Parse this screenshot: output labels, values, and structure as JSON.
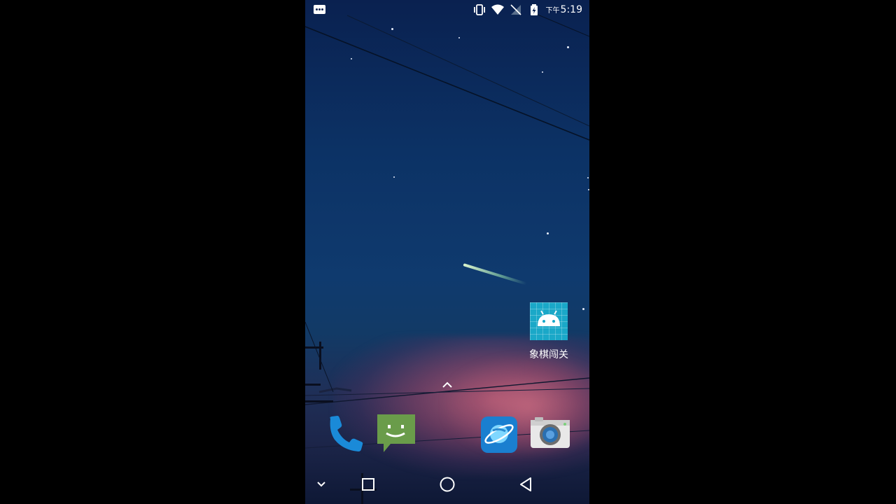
{
  "status_bar": {
    "ampm": "下午",
    "time": "5:19",
    "icons": [
      "notification-dots-icon",
      "vibrate-icon",
      "wifi-icon",
      "no-signal-icon",
      "battery-charging-icon"
    ]
  },
  "desktop": {
    "app": {
      "label": "象棋闯关",
      "icon": "android-icon"
    }
  },
  "dock": {
    "apps": [
      {
        "name": "phone",
        "icon": "phone-icon"
      },
      {
        "name": "messages",
        "icon": "messages-icon"
      },
      {
        "name": "browser",
        "icon": "browser-planet-icon"
      },
      {
        "name": "camera",
        "icon": "camera-icon"
      }
    ]
  },
  "navbar": {
    "buttons": [
      "chevron-down-icon",
      "recents-square-icon",
      "home-circle-icon",
      "back-triangle-icon"
    ]
  },
  "colors": {
    "sky_top": "#0a2150",
    "sky_mid": "#0f3a6e",
    "cloud_pink": "#be5f78",
    "app_tile": "#1aa8c8",
    "phone_blue": "#1a8ad8",
    "messages_green": "#6a9c4a",
    "browser_blue": "#1a7fd0"
  }
}
